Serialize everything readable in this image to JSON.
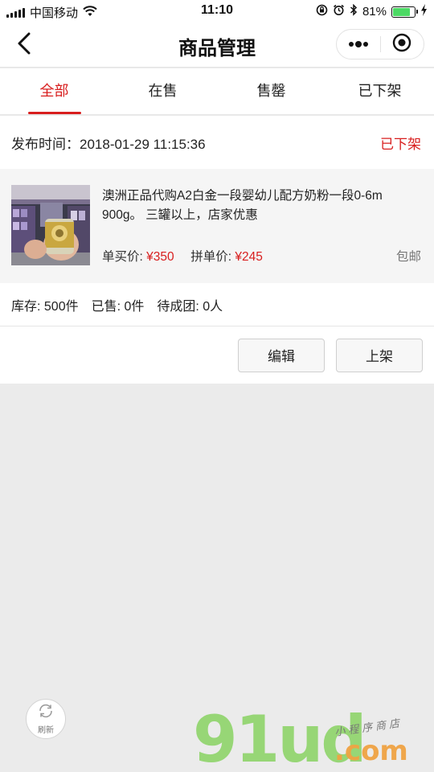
{
  "status_bar": {
    "carrier": "中国移动",
    "time": "11:10",
    "battery": "81%",
    "battery_level": 0.81
  },
  "nav": {
    "title": "商品管理"
  },
  "tabs": [
    {
      "label": "全部",
      "active": true
    },
    {
      "label": "在售",
      "active": false
    },
    {
      "label": "售罄",
      "active": false
    },
    {
      "label": "已下架",
      "active": false
    }
  ],
  "order": {
    "publish_label": "发布时间：2018-01-29 11:15:36",
    "status": "已下架",
    "product_title": "澳洲正品代购A2白金一段婴幼儿配方奶粉一段0-6m 900g。 三罐以上，店家优惠",
    "single_price_label": "单买价:",
    "single_price": "¥350",
    "group_price_label": "拼单价:",
    "group_price": "¥245",
    "shipping": "包邮",
    "stock": "库存: 500件",
    "sold": "已售: 0件",
    "pending": "待成团: 0人",
    "edit_label": "编辑",
    "publish_button_label": "上架"
  },
  "refresh": {
    "label": "刷新"
  },
  "watermark": {
    "main": "91ud",
    "suffix": ".com",
    "tagline": "小程序商店"
  },
  "colors": {
    "accent": "#d81e1e",
    "background": "#ebebeb",
    "card": "#ffffff",
    "product_bg": "#f5f5f5"
  }
}
